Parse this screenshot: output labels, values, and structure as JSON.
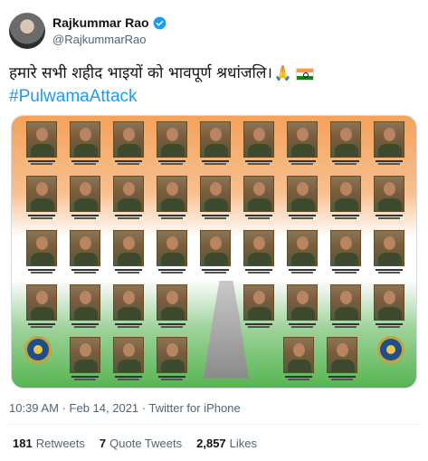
{
  "tweet": {
    "author_name": "Rajkummar Rao",
    "author_handle": "@RajkummarRao",
    "verified": true,
    "text": "हमारे सभी शहीद भाइयों को भावपूर्ण श्रधांजलि।",
    "emoji": "🙏",
    "hashtag": "#PulwamaAttack",
    "time": "10:39 AM",
    "date": "Feb 14, 2021",
    "source": "Twitter for iPhone",
    "meta_separator": "·"
  },
  "stats": {
    "retweets_count": "181",
    "retweets_label": "Retweets",
    "quotes_count": "7",
    "quotes_label": "Quote Tweets",
    "likes_count": "2,857",
    "likes_label": "Likes"
  },
  "icons": {
    "verified": "verified-badge-icon",
    "more": "more-options-icon",
    "flag": "india-flag-icon"
  },
  "colors": {
    "link": "#1d9bf0",
    "secondary_text": "#536471",
    "saffron": "#ff9933",
    "green": "#138808"
  }
}
